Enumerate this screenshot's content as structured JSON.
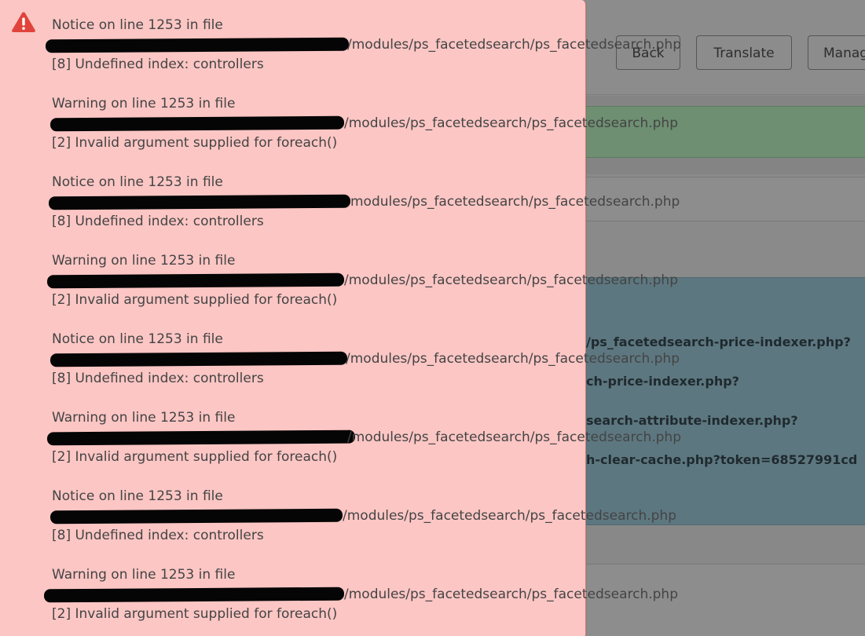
{
  "toolbar": {
    "back_label": "Back",
    "translate_label": "Translate",
    "manage_label": "Manage"
  },
  "cron_urls": [
    "/ps_facetedsearch-price-indexer.php?",
    "ch-price-indexer.php?",
    "search-attribute-indexer.php?",
    "h-clear-cache.php?token=68527991cd"
  ],
  "errors": [
    {
      "heading": "Notice on line 1253 in file",
      "path_suffix": "/modules/ps_facetedsearch/ps_facetedsearch.php",
      "message": "[8] Undefined index: controllers"
    },
    {
      "heading": "Warning on line 1253 in file",
      "path_suffix": "/modules/ps_facetedsearch/ps_facetedsearch.php",
      "message": "[2] Invalid argument supplied for foreach()"
    },
    {
      "heading": "Notice on line 1253 in file",
      "path_suffix": "modules/ps_facetedsearch/ps_facetedsearch.php",
      "message": "[8] Undefined index: controllers"
    },
    {
      "heading": "Warning on line 1253 in file",
      "path_suffix": "/modules/ps_facetedsearch/ps_facetedsearch.php",
      "message": "[2] Invalid argument supplied for foreach()"
    },
    {
      "heading": "Notice on line 1253 in file",
      "path_suffix": "/modules/ps_facetedsearch/ps_facetedsearch.php",
      "message": "[8] Undefined index: controllers"
    },
    {
      "heading": "Warning on line 1253 in file",
      "path_suffix": "/modules/ps_facetedsearch/ps_facetedsearch.php",
      "message": "[2] Invalid argument supplied for foreach()"
    },
    {
      "heading": "Notice on line 1253 in file",
      "path_suffix": "/modules/ps_facetedsearch/ps_facetedsearch.php",
      "message": "[8] Undefined index: controllers"
    },
    {
      "heading": "Warning on line 1253 in file",
      "path_suffix": "/modules/ps_facetedsearch/ps_facetedsearch.php",
      "message": "[2] Invalid argument supplied for foreach()"
    }
  ],
  "colors": {
    "error_panel_bg": "#fbc6c4",
    "alert_icon": "#e0433b",
    "redaction": "#050505"
  },
  "icons": {
    "alert": "warning-triangle-icon"
  }
}
